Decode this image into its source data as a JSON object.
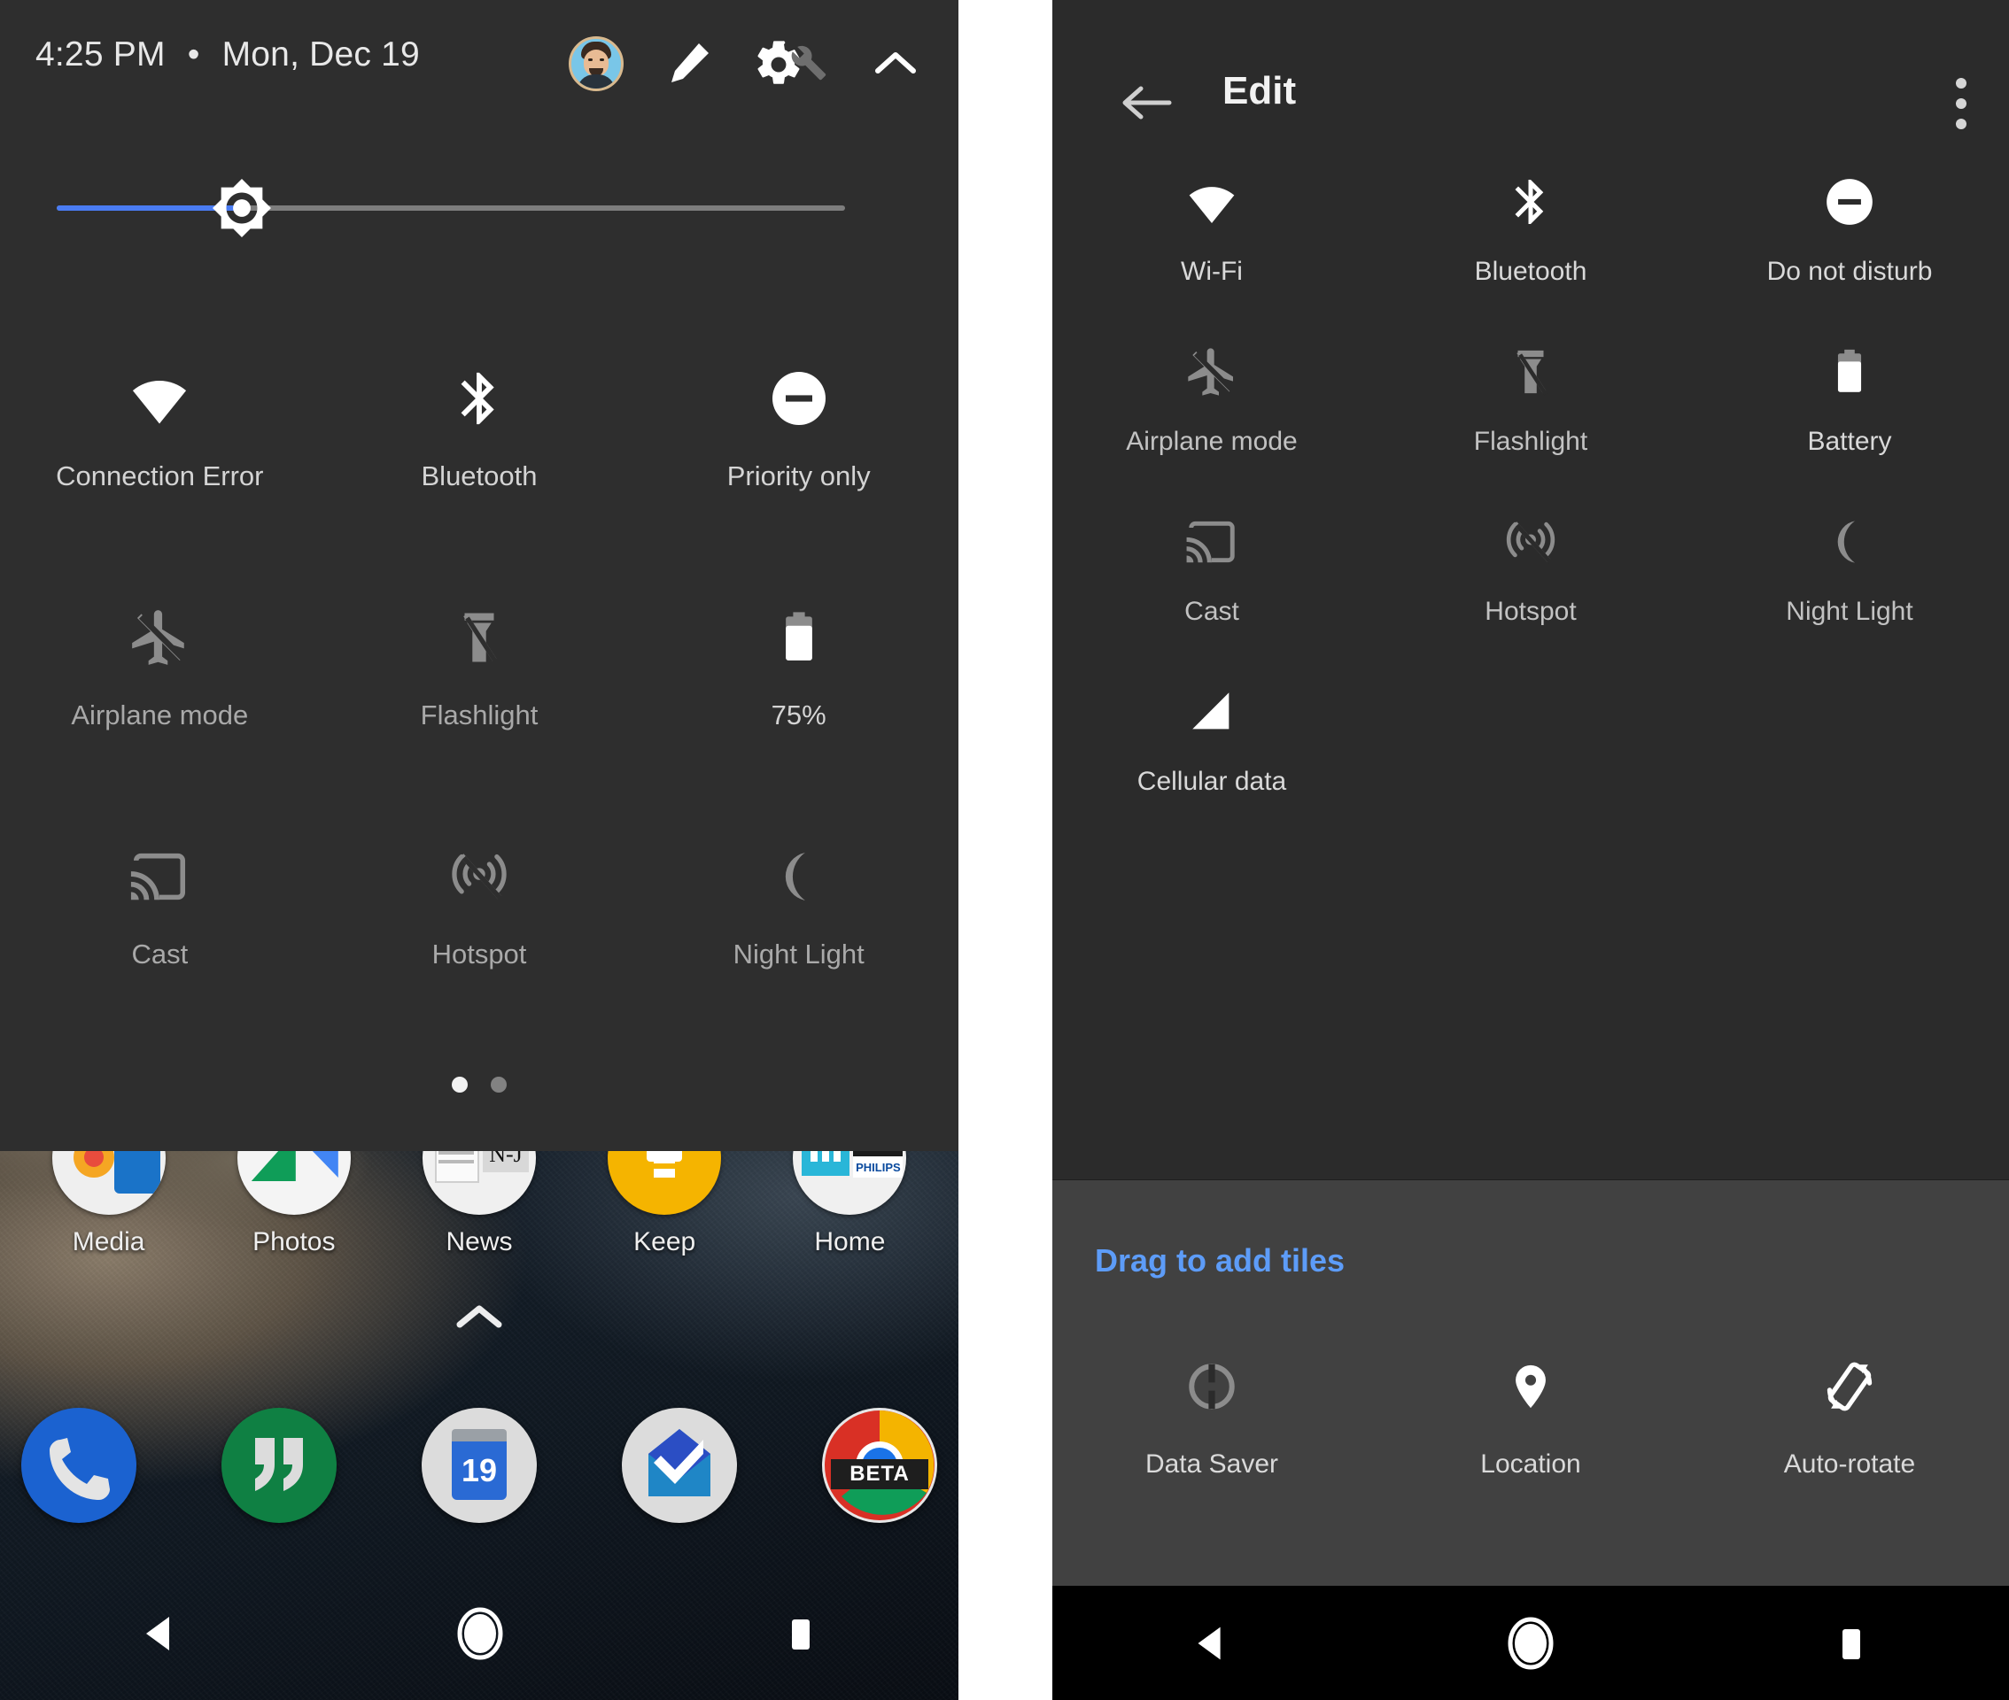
{
  "left_phone": {
    "quick_settings": {
      "status": {
        "time": "4:25 PM",
        "separator": "•",
        "date": "Mon, Dec 19"
      },
      "header_icons": [
        {
          "name": "user-avatar",
          "label": "User avatar"
        },
        {
          "name": "edit-pencil-icon",
          "label": "Edit"
        },
        {
          "name": "settings-gear-icon",
          "label": "Settings"
        },
        {
          "name": "collapse-chevron-icon",
          "label": "Collapse"
        }
      ],
      "brightness": {
        "name": "brightness-slider",
        "value_percent": 23
      },
      "tiles": [
        [
          {
            "label": "Connection Error",
            "icon": "wifi-icon",
            "state": "active"
          },
          {
            "label": "Bluetooth",
            "icon": "bluetooth-icon",
            "state": "active"
          },
          {
            "label": "Priority only",
            "icon": "do-not-disturb-icon",
            "state": "active"
          }
        ],
        [
          {
            "label": "Airplane mode",
            "icon": "airplane-off-icon",
            "state": "inactive"
          },
          {
            "label": "Flashlight",
            "icon": "flashlight-off-icon",
            "state": "inactive"
          },
          {
            "label": "75%",
            "icon": "battery-icon",
            "state": "active"
          }
        ],
        [
          {
            "label": "Cast",
            "icon": "cast-icon",
            "state": "inactive"
          },
          {
            "label": "Hotspot",
            "icon": "hotspot-off-icon",
            "state": "inactive"
          },
          {
            "label": "Night Light",
            "icon": "night-light-moon-icon",
            "state": "inactive"
          }
        ]
      ],
      "page_indicator": {
        "pages": 2,
        "current": 1
      }
    },
    "home_screen": {
      "apps": [
        {
          "label": "Media",
          "icon": "media-folder-icon"
        },
        {
          "label": "Photos",
          "icon": "google-photos-icon"
        },
        {
          "label": "News",
          "icon": "news-folder-icon"
        },
        {
          "label": "Keep",
          "icon": "google-keep-icon"
        },
        {
          "label": "Home",
          "icon": "home-folder-icon"
        }
      ],
      "all_apps_chevron": "all-apps-chevron-icon",
      "dock": [
        {
          "name": "phone-app-icon",
          "label": "Phone"
        },
        {
          "name": "hangouts-app-icon",
          "label": "Hangouts"
        },
        {
          "name": "calendar-app-icon",
          "label": "Calendar",
          "day": "19"
        },
        {
          "name": "inbox-app-icon",
          "label": "Inbox"
        },
        {
          "name": "chrome-beta-app-icon",
          "label": "Chrome Beta",
          "badge": "BETA"
        }
      ]
    },
    "nav_bar": [
      {
        "name": "back-nav-button",
        "label": "Back"
      },
      {
        "name": "home-nav-button",
        "label": "Home"
      },
      {
        "name": "recents-nav-button",
        "label": "Recents"
      }
    ]
  },
  "right_phone": {
    "header": {
      "back": "back-arrow-icon",
      "title": "Edit",
      "overflow": "overflow-menu-icon"
    },
    "active_tiles": [
      [
        {
          "label": "Wi-Fi",
          "icon": "wifi-icon",
          "state": "active"
        },
        {
          "label": "Bluetooth",
          "icon": "bluetooth-icon",
          "state": "active"
        },
        {
          "label": "Do not disturb",
          "icon": "do-not-disturb-icon",
          "state": "active"
        }
      ],
      [
        {
          "label": "Airplane mode",
          "icon": "airplane-off-icon",
          "state": "inactive"
        },
        {
          "label": "Flashlight",
          "icon": "flashlight-off-icon",
          "state": "inactive"
        },
        {
          "label": "Battery",
          "icon": "battery-icon",
          "state": "active"
        }
      ],
      [
        {
          "label": "Cast",
          "icon": "cast-icon",
          "state": "inactive"
        },
        {
          "label": "Hotspot",
          "icon": "hotspot-off-icon",
          "state": "inactive"
        },
        {
          "label": "Night Light",
          "icon": "night-light-moon-icon",
          "state": "inactive"
        }
      ],
      [
        {
          "label": "Cellular data",
          "icon": "cellular-signal-icon",
          "state": "active"
        },
        {
          "label": "",
          "icon": "",
          "state": "empty"
        },
        {
          "label": "",
          "icon": "",
          "state": "empty"
        }
      ]
    ],
    "add_section": {
      "heading": "Drag to add tiles",
      "tiles": [
        [
          {
            "label": "Data Saver",
            "icon": "data-saver-icon",
            "state": "inactive"
          },
          {
            "label": "Location",
            "icon": "location-pin-icon",
            "state": "active"
          },
          {
            "label": "Auto-rotate",
            "icon": "auto-rotate-icon",
            "state": "active"
          }
        ]
      ]
    },
    "nav_bar": [
      {
        "name": "back-nav-button",
        "label": "Back"
      },
      {
        "name": "home-nav-button",
        "label": "Home"
      },
      {
        "name": "recents-nav-button",
        "label": "Recents"
      }
    ]
  },
  "colors": {
    "qs_background": "#2e2e2e",
    "edit_background": "#2b2b2b",
    "add_section_background": "#414141",
    "accent_blue": "#5d9cf8",
    "slider_fill": "#4a7cf3",
    "active_icon": "#ffffff",
    "inactive_icon": "#8c8c8c",
    "label_text": "#d4d4d4",
    "nav_bar": "#000000"
  }
}
